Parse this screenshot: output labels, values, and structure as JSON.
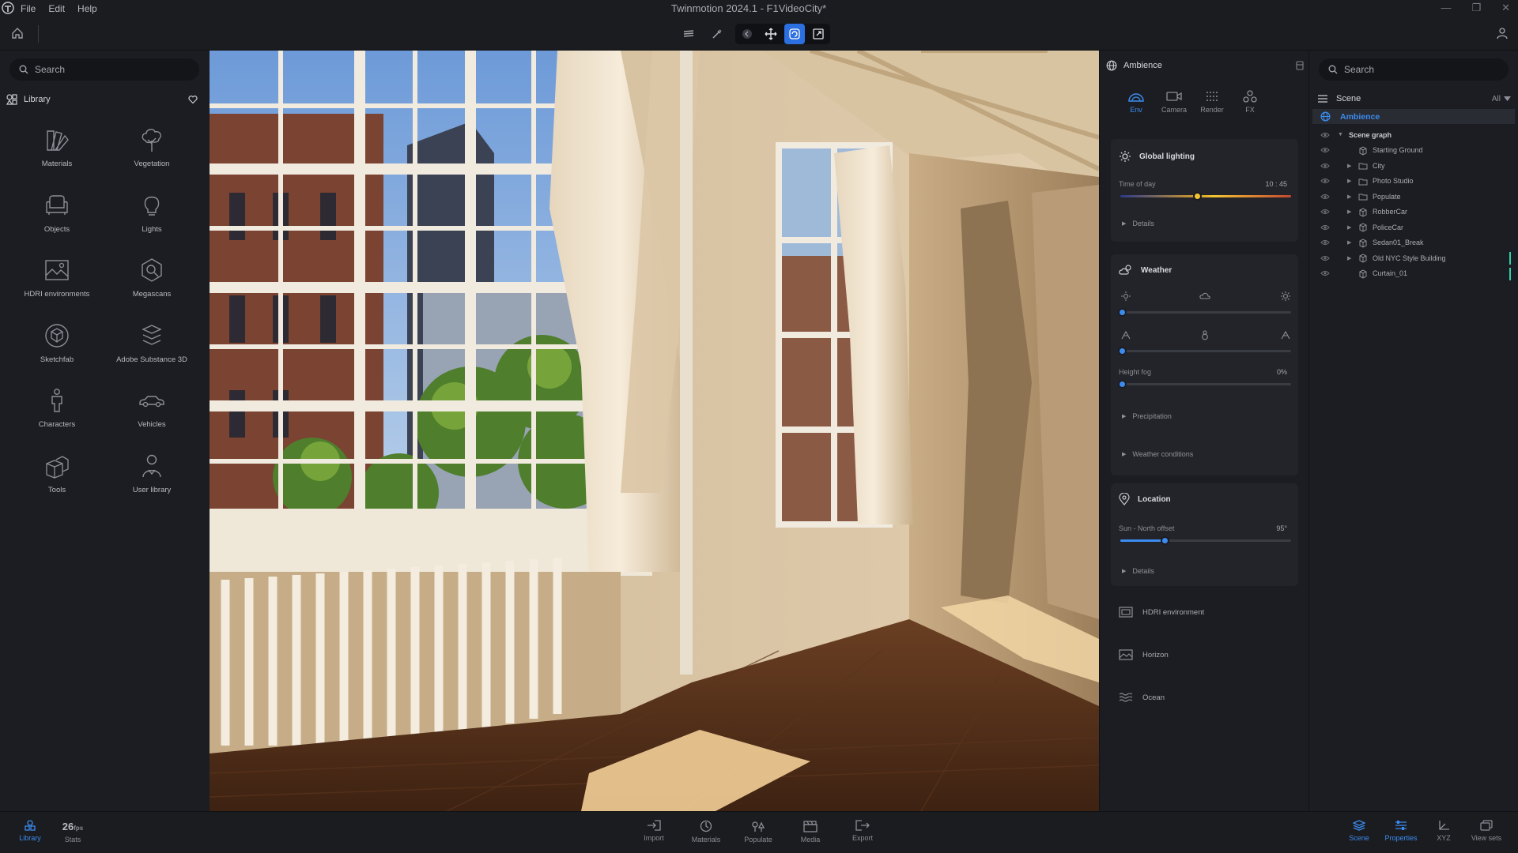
{
  "window": {
    "title": "Twinmotion 2024.1 - F1VideoCity*",
    "menu": [
      "File",
      "Edit",
      "Help"
    ]
  },
  "library": {
    "search_placeholder": "Search",
    "header": "Library",
    "items": [
      {
        "label": "Materials",
        "icon": "materials-icon"
      },
      {
        "label": "Vegetation",
        "icon": "tree-icon"
      },
      {
        "label": "Objects",
        "icon": "sofa-icon"
      },
      {
        "label": "Lights",
        "icon": "bulb-icon"
      },
      {
        "label": "HDRI environments",
        "icon": "hdri-icon"
      },
      {
        "label": "Megascans",
        "icon": "megascans-icon"
      },
      {
        "label": "Sketchfab",
        "icon": "sketchfab-icon"
      },
      {
        "label": "Adobe Substance 3D",
        "icon": "substance-icon"
      },
      {
        "label": "Characters",
        "icon": "person-icon"
      },
      {
        "label": "Vehicles",
        "icon": "car-icon"
      },
      {
        "label": "Tools",
        "icon": "boxes-icon"
      },
      {
        "label": "User library",
        "icon": "user-library-icon"
      }
    ]
  },
  "properties": {
    "header": "Ambience",
    "tabs": [
      {
        "label": "Env",
        "active": true
      },
      {
        "label": "Camera",
        "active": false
      },
      {
        "label": "Render",
        "active": false
      },
      {
        "label": "FX",
        "active": false
      }
    ],
    "global_lighting": {
      "title": "Global lighting",
      "time_label": "Time of day",
      "time_value": "10 : 45",
      "time_fraction": 0.45,
      "details": "Details"
    },
    "weather": {
      "title": "Weather",
      "height_fog_label": "Height fog",
      "height_fog_value": "0%",
      "precipitation": "Precipitation",
      "conditions": "Weather conditions"
    },
    "location": {
      "title": "Location",
      "sun_label": "Sun - North offset",
      "sun_value": "95°",
      "sun_fraction": 0.26,
      "details": "Details"
    },
    "extras": [
      "HDRI environment",
      "Horizon",
      "Ocean"
    ]
  },
  "scene": {
    "search_placeholder": "Search",
    "header": "Scene",
    "filter": "All",
    "selected": "Ambience",
    "graph_label": "Scene graph",
    "nodes": [
      {
        "label": "Starting Ground",
        "type": "object",
        "expandable": false,
        "bar": false
      },
      {
        "label": "City",
        "type": "folder",
        "expandable": true,
        "bar": false
      },
      {
        "label": "Photo Studio",
        "type": "folder",
        "expandable": true,
        "bar": false
      },
      {
        "label": "Populate",
        "type": "folder",
        "expandable": true,
        "bar": false
      },
      {
        "label": "RobberCar",
        "type": "object",
        "expandable": true,
        "bar": false
      },
      {
        "label": "PoliceCar",
        "type": "object",
        "expandable": true,
        "bar": false
      },
      {
        "label": "Sedan01_Break",
        "type": "object",
        "expandable": true,
        "bar": false
      },
      {
        "label": "Old NYC Style Building",
        "type": "object",
        "expandable": true,
        "bar": true
      },
      {
        "label": "Curtain_01",
        "type": "object",
        "expandable": false,
        "bar": true
      }
    ]
  },
  "bottom": {
    "left": [
      {
        "label": "Library",
        "active": true
      }
    ],
    "stats": {
      "label": "Stats",
      "value": "26",
      "unit": "fps"
    },
    "center": [
      "Import",
      "Materials",
      "Populate",
      "Media",
      "Export"
    ],
    "right": [
      {
        "label": "Scene",
        "active": true
      },
      {
        "label": "Properties",
        "active": true
      },
      {
        "label": "XYZ",
        "active": false
      },
      {
        "label": "View sets",
        "active": false
      }
    ]
  },
  "colors": {
    "accent": "#3b8cf0",
    "panel": "#1c1d22",
    "scene_bar": "#2fd0a6"
  }
}
